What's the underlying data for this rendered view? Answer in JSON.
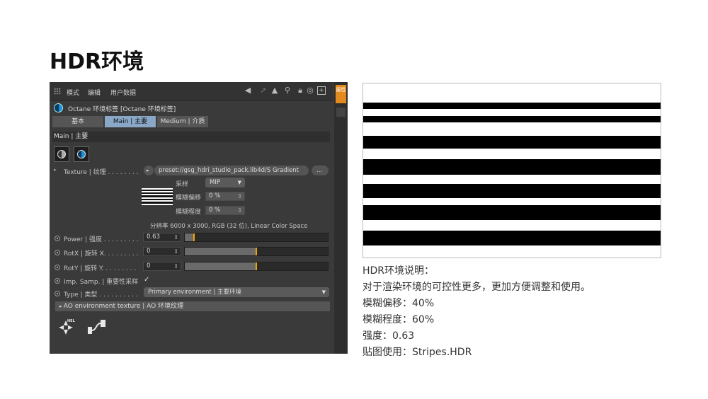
{
  "slide_title": "HDR环境",
  "menubar": {
    "items": [
      "模式",
      "编辑",
      "用户数据"
    ]
  },
  "tag_title": "Octane 环境标签 [Octane 环境标签]",
  "tabs": [
    "基本",
    "Main | 主要",
    "Medium | 介质"
  ],
  "section_label": "Main | 主要",
  "texture": {
    "label": "Texture | 纹理 . . . . . . . .",
    "path": "preset://gsg_hdri_studio_pack.lib4d/S Gradient",
    "browse": "...",
    "sampling_label": "采样",
    "sampling_value": "MIP",
    "blur_offset_label": "模糊偏移",
    "blur_offset_value": "0 %",
    "blur_amount_label": "模糊程度",
    "blur_amount_value": "0 %",
    "resolution": "分辨率 6000 x 3000, RGB (32 位), Linear Color Space"
  },
  "power": {
    "label": "Power | 强度 . . . . . . . . .",
    "value": "0.63",
    "level": 0.063
  },
  "rotx": {
    "label": "RotX | 旋转 X. . . . . . . . .",
    "value": "0",
    "level": 0.5
  },
  "roty": {
    "label": "RotY | 旋转 Y. . . . . . . . .",
    "value": "0",
    "level": 0.5
  },
  "imp_samp": {
    "label": "Imp. Samp. | 重要性采样",
    "checkmark": "✓"
  },
  "type": {
    "label": "Type | 类型 . . . . . . . . . .",
    "value": "Primary environment | 主要环境"
  },
  "ao_row": "AO environment texture | AO 环境纹理",
  "sidebar_tab": "属性",
  "notes": [
    "HDR环境说明：",
    "对于渲染环境的可控性更多，更加方便调整和使用。",
    "模糊偏移：40%",
    "模糊程度：60%",
    "强度：0.63",
    "贴图使用：Stripes.HDR"
  ]
}
